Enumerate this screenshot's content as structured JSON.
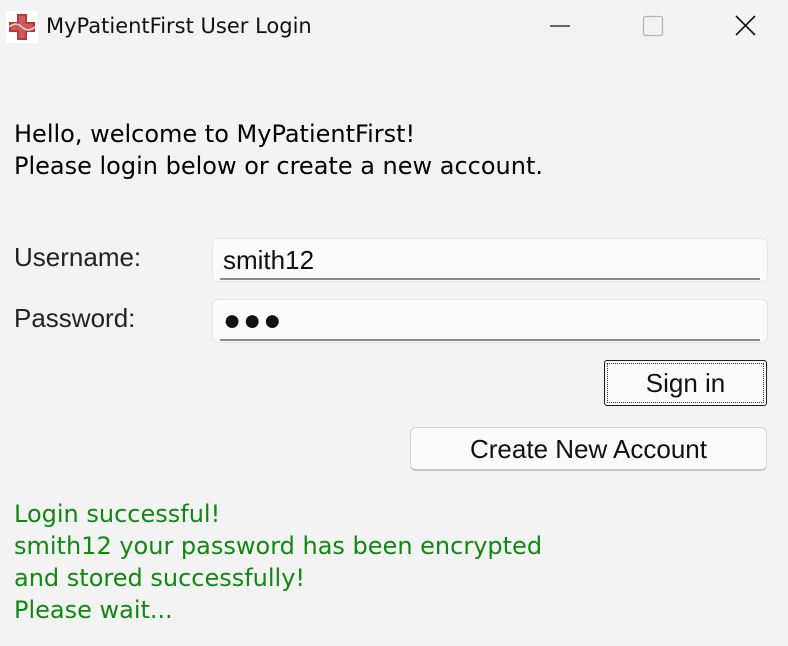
{
  "window": {
    "title": "MyPatientFirst User Login",
    "icon": "medical-cross-icon",
    "controls": [
      "minimize-icon",
      "maximize-icon",
      "close-icon"
    ]
  },
  "welcome": {
    "line1": "Hello, welcome to MyPatientFirst!",
    "line2": "Please login below or create a new account."
  },
  "form": {
    "username_label": "Username:",
    "username_value": "smith12",
    "password_label": "Password:",
    "password_value": "●●●"
  },
  "buttons": {
    "sign_in": "Sign in",
    "create_account": "Create New Account"
  },
  "status": {
    "lines": [
      "Login successful!",
      "smith12 your password has been encrypted",
      "and stored successfully!",
      "Please wait..."
    ]
  },
  "colors": {
    "background": "#f3f3f3",
    "status_text": "#118811",
    "icon_red": "#b23a3a"
  }
}
